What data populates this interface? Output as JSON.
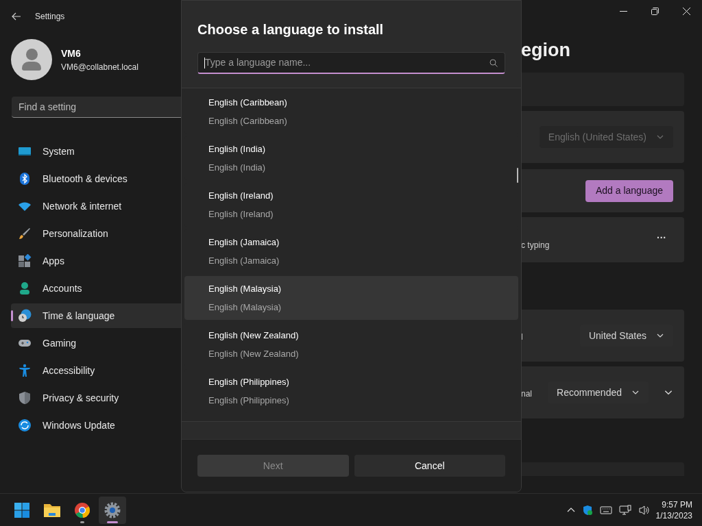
{
  "window": {
    "title": "Settings"
  },
  "profile": {
    "name": "VM6",
    "email": "VM6@collabnet.local"
  },
  "search": {
    "placeholder": "Find a setting"
  },
  "sidebar": {
    "items": [
      {
        "label": "System",
        "selected": false
      },
      {
        "label": "Bluetooth & devices",
        "selected": false
      },
      {
        "label": "Network & internet",
        "selected": false
      },
      {
        "label": "Personalization",
        "selected": false
      },
      {
        "label": "Apps",
        "selected": false
      },
      {
        "label": "Accounts",
        "selected": false
      },
      {
        "label": "Time & language",
        "selected": true
      },
      {
        "label": "Gaming",
        "selected": false
      },
      {
        "label": "Accessibility",
        "selected": false
      },
      {
        "label": "Privacy & security",
        "selected": false
      },
      {
        "label": "Windows Update",
        "selected": false
      }
    ]
  },
  "page": {
    "title_fragment": "egion",
    "cards": [
      {
        "kind": "empty"
      },
      {
        "kind": "dropdown",
        "value": "English (United States)",
        "disabled": true
      },
      {
        "kind": "button",
        "label": "Add a language"
      },
      {
        "kind": "more",
        "text": "c typing",
        "more": "···"
      },
      {
        "kind": "gap"
      },
      {
        "kind": "dropdown",
        "fragment": "l",
        "value": "United States",
        "disabled": false
      },
      {
        "kind": "dropdown-expand",
        "fragment": "nal",
        "value": "Recommended",
        "disabled": false
      }
    ]
  },
  "dialog": {
    "title": "Choose a language to install",
    "search_placeholder": "Type a language name...",
    "languages": [
      {
        "name": "English (Caribbean)",
        "native": "English (Caribbean)",
        "hovered": false
      },
      {
        "name": "English (India)",
        "native": "English (India)",
        "hovered": false
      },
      {
        "name": "English (Ireland)",
        "native": "English (Ireland)",
        "hovered": false
      },
      {
        "name": "English (Jamaica)",
        "native": "English (Jamaica)",
        "hovered": false
      },
      {
        "name": "English (Malaysia)",
        "native": "English (Malaysia)",
        "hovered": true
      },
      {
        "name": "English (New Zealand)",
        "native": "English (New Zealand)",
        "hovered": false
      },
      {
        "name": "English (Philippines)",
        "native": "English (Philippines)",
        "hovered": false
      }
    ],
    "buttons": [
      {
        "label": "Next",
        "kind": "primary",
        "disabled": true
      },
      {
        "label": "Cancel",
        "kind": "secondary",
        "disabled": false
      }
    ]
  },
  "taskbar": {
    "apps": [
      {
        "running": false,
        "active": false
      },
      {
        "running": false,
        "active": false
      },
      {
        "running": true,
        "active": false
      },
      {
        "running": true,
        "active": true
      }
    ],
    "time": "9:57 PM",
    "date": "1/13/2023"
  }
}
